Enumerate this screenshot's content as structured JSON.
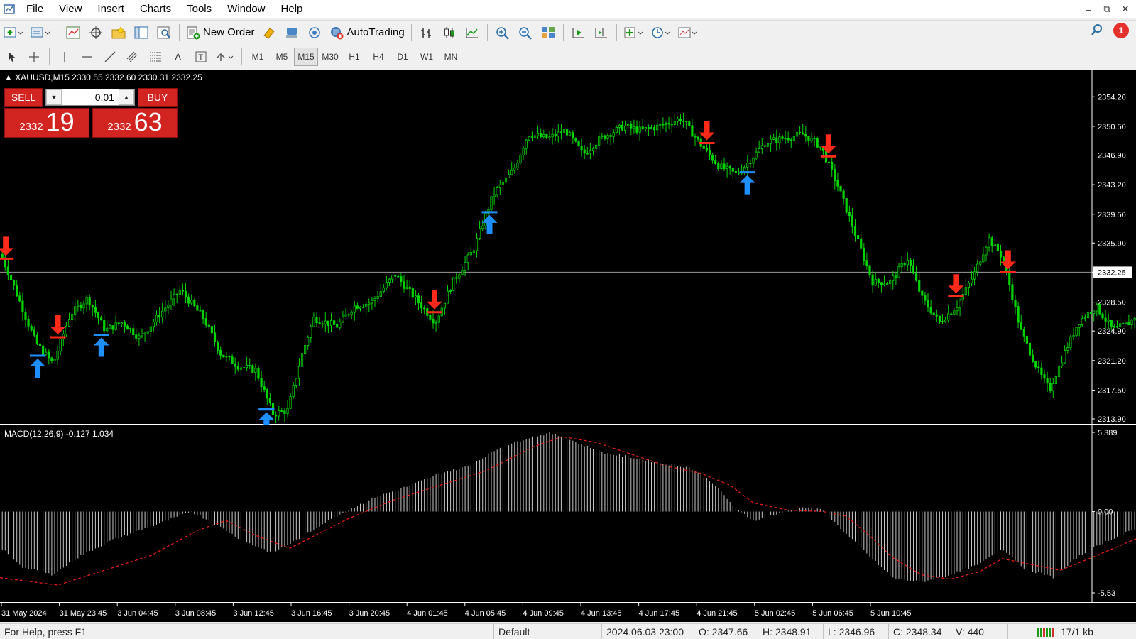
{
  "menu": {
    "items": [
      "File",
      "View",
      "Insert",
      "Charts",
      "Tools",
      "Window",
      "Help"
    ]
  },
  "toolbar": {
    "new_order_label": "New Order",
    "autotrading_label": "AutoTrading",
    "notification_count": "1"
  },
  "timeframes": {
    "items": [
      "M1",
      "M5",
      "M15",
      "M30",
      "H1",
      "H4",
      "D1",
      "W1",
      "MN"
    ],
    "active": "M15"
  },
  "chart": {
    "symbol_header": "XAUUSD,M15  2330.55 2332.60 2330.31 2332.25",
    "macd_header": "MACD(12,26,9) -0.127 1.034",
    "colors": {
      "background": "#000000",
      "bull_candle": "#00d400",
      "sell_arrow": "#ff2a1a",
      "buy_arrow": "#1e8fff",
      "macd_hist": "#c8c8c8",
      "macd_signal": "#e51a1a"
    }
  },
  "trade_panel": {
    "sell_label": "SELL",
    "buy_label": "BUY",
    "lot": "0.01",
    "sell_price_main": "2332",
    "sell_price_big": "19",
    "buy_price_main": "2332",
    "buy_price_big": "63"
  },
  "chart_data": {
    "type": "candlestick",
    "price_axis_ticks": [
      "2354.20",
      "2350.50",
      "2346.90",
      "2343.20",
      "2339.50",
      "2335.90",
      "2332.25",
      "2328.50",
      "2324.90",
      "2321.20",
      "2317.50",
      "2313.90"
    ],
    "current_price": "2332.25",
    "ylim": [
      2313.9,
      2356.0
    ],
    "time_axis_ticks": [
      "31 May 2024",
      "31 May 23:45",
      "3 Jun 04:45",
      "3 Jun 08:45",
      "3 Jun 12:45",
      "3 Jun 16:45",
      "3 Jun 20:45",
      "4 Jun 01:45",
      "4 Jun 05:45",
      "4 Jun 09:45",
      "4 Jun 13:45",
      "4 Jun 17:45",
      "4 Jun 21:45",
      "5 Jun 02:45",
      "5 Jun 06:45",
      "5 Jun 10:45"
    ],
    "price_path": [
      [
        0,
        2334.5
      ],
      [
        0.25,
        2330.0
      ],
      [
        0.6,
        2323.5
      ],
      [
        0.9,
        2320.8
      ],
      [
        1.2,
        2327.0
      ],
      [
        1.5,
        2329.0
      ],
      [
        1.8,
        2325.0
      ],
      [
        2.1,
        2326.0
      ],
      [
        2.4,
        2324.0
      ],
      [
        2.8,
        2327.5
      ],
      [
        3.1,
        2330.0
      ],
      [
        3.5,
        2326.5
      ],
      [
        3.8,
        2322.0
      ],
      [
        4.1,
        2320.5
      ],
      [
        4.4,
        2320.0
      ],
      [
        4.7,
        2314.5
      ],
      [
        4.95,
        2315.0
      ],
      [
        5.2,
        2322.0
      ],
      [
        5.4,
        2326.5
      ],
      [
        5.8,
        2325.5
      ],
      [
        6.1,
        2328.0
      ],
      [
        6.4,
        2328.5
      ],
      [
        6.8,
        2332.0
      ],
      [
        7.15,
        2329.0
      ],
      [
        7.5,
        2326.0
      ],
      [
        7.8,
        2331.0
      ],
      [
        8.15,
        2335.0
      ],
      [
        8.5,
        2342.0
      ],
      [
        8.85,
        2345.0
      ],
      [
        9.1,
        2349.5
      ],
      [
        9.45,
        2349.0
      ],
      [
        9.75,
        2350.0
      ],
      [
        10.05,
        2347.0
      ],
      [
        10.35,
        2349.0
      ],
      [
        10.75,
        2350.5
      ],
      [
        11.05,
        2350.0
      ],
      [
        11.35,
        2350.5
      ],
      [
        11.75,
        2351.5
      ],
      [
        12.1,
        2348.0
      ],
      [
        12.4,
        2345.5
      ],
      [
        12.7,
        2344.5
      ],
      [
        12.9,
        2346.0
      ],
      [
        13.2,
        2348.5
      ],
      [
        13.5,
        2349.0
      ],
      [
        13.85,
        2349.5
      ],
      [
        14.15,
        2348.0
      ],
      [
        14.45,
        2343.0
      ],
      [
        14.75,
        2337.0
      ],
      [
        15.05,
        2331.0
      ],
      [
        15.35,
        2331.0
      ],
      [
        15.65,
        2334.0
      ],
      [
        15.9,
        2329.0
      ],
      [
        16.2,
        2326.0
      ],
      [
        16.5,
        2328.0
      ],
      [
        16.8,
        2332.0
      ],
      [
        17.05,
        2336.5
      ],
      [
        17.3,
        2334.0
      ],
      [
        17.6,
        2325.0
      ],
      [
        17.9,
        2320.0
      ],
      [
        18.1,
        2317.5
      ],
      [
        18.35,
        2322.0
      ],
      [
        18.6,
        2326.0
      ],
      [
        18.9,
        2328.0
      ],
      [
        19.2,
        2325.0
      ],
      [
        19.5,
        2326.0
      ],
      [
        19.8,
        2329.0
      ],
      [
        20.1,
        2329.5
      ],
      [
        20.4,
        2328.0
      ],
      [
        20.7,
        2327.5
      ],
      [
        21.0,
        2326.0
      ],
      [
        21.3,
        2326.0
      ],
      [
        21.6,
        2327.0
      ],
      [
        21.9,
        2328.0
      ],
      [
        22.2,
        2328.3
      ],
      [
        22.5,
        2328.5
      ],
      [
        22.75,
        2329.5
      ],
      [
        23.05,
        2327.5
      ],
      [
        23.35,
        2331.0
      ],
      [
        23.65,
        2334.0
      ],
      [
        23.95,
        2336.0
      ],
      [
        24.25,
        2335.0
      ],
      [
        24.55,
        2339.0
      ],
      [
        24.8,
        2340.5
      ],
      [
        25.05,
        2336.5
      ],
      [
        25.3,
        2331.0
      ],
      [
        25.55,
        2330.0
      ],
      [
        25.8,
        2329.0
      ],
      [
        26.0,
        2332.2
      ]
    ],
    "sell_signals": [
      0.1,
      1.0,
      7.5,
      12.2,
      14.3,
      16.5,
      17.4,
      21.4
    ],
    "buy_signals": [
      0.65,
      1.75,
      4.6,
      4.6,
      8.45,
      12.9,
      20.3,
      23.5
    ],
    "macd": {
      "ylim": [
        -5.53,
        5.389
      ],
      "axis_ticks": [
        "5.389",
        "0.00",
        "-5.53"
      ],
      "histogram_path": [
        [
          0,
          -2.4
        ],
        [
          0.4,
          -3.8
        ],
        [
          0.9,
          -4.3
        ],
        [
          1.4,
          -3.0
        ],
        [
          1.9,
          -2.0
        ],
        [
          2.4,
          -1.3
        ],
        [
          2.9,
          -0.6
        ],
        [
          3.3,
          0.0
        ],
        [
          3.7,
          -0.8
        ],
        [
          4.2,
          -2.0
        ],
        [
          4.7,
          -2.8
        ],
        [
          5.0,
          -2.2
        ],
        [
          5.5,
          -1.0
        ],
        [
          6.0,
          0.1
        ],
        [
          6.5,
          1.0
        ],
        [
          7.1,
          1.8
        ],
        [
          7.6,
          2.6
        ],
        [
          8.1,
          3.1
        ],
        [
          8.6,
          4.3
        ],
        [
          9.1,
          5.0
        ],
        [
          9.5,
          5.35
        ],
        [
          9.9,
          4.8
        ],
        [
          10.4,
          4.0
        ],
        [
          10.9,
          3.7
        ],
        [
          11.4,
          3.3
        ],
        [
          11.9,
          3.0
        ],
        [
          12.3,
          2.0
        ],
        [
          12.7,
          0.2
        ],
        [
          13.0,
          -0.6
        ],
        [
          13.4,
          -0.2
        ],
        [
          13.8,
          0.3
        ],
        [
          14.2,
          0.1
        ],
        [
          14.6,
          -1.5
        ],
        [
          15.0,
          -3.0
        ],
        [
          15.4,
          -4.5
        ],
        [
          15.9,
          -4.8
        ],
        [
          16.4,
          -4.3
        ],
        [
          16.9,
          -3.6
        ],
        [
          17.3,
          -2.5
        ],
        [
          17.7,
          -3.9
        ],
        [
          18.2,
          -4.5
        ],
        [
          18.6,
          -3.1
        ],
        [
          19.1,
          -2.0
        ],
        [
          19.6,
          -1.2
        ],
        [
          20.1,
          -0.6
        ],
        [
          20.6,
          -0.3
        ],
        [
          21.1,
          -0.1
        ],
        [
          21.6,
          0.2
        ],
        [
          22.1,
          0.4
        ],
        [
          22.6,
          0.5
        ],
        [
          23.1,
          1.0
        ],
        [
          23.6,
          2.2
        ],
        [
          24.1,
          3.4
        ],
        [
          24.6,
          4.0
        ],
        [
          25.0,
          3.0
        ],
        [
          25.4,
          1.5
        ],
        [
          25.8,
          0.1
        ],
        [
          26.0,
          0.0
        ]
      ],
      "signal_path": [
        [
          0,
          -4.5
        ],
        [
          1.0,
          -5.0
        ],
        [
          1.8,
          -4.0
        ],
        [
          2.6,
          -3.0
        ],
        [
          3.4,
          -1.3
        ],
        [
          3.9,
          -0.6
        ],
        [
          4.4,
          -1.6
        ],
        [
          5.0,
          -2.5
        ],
        [
          5.5,
          -1.5
        ],
        [
          6.0,
          -0.5
        ],
        [
          6.8,
          0.8
        ],
        [
          7.6,
          1.8
        ],
        [
          8.4,
          2.8
        ],
        [
          9.2,
          4.4
        ],
        [
          9.7,
          5.1
        ],
        [
          10.3,
          4.7
        ],
        [
          10.9,
          3.9
        ],
        [
          11.5,
          3.1
        ],
        [
          12.1,
          2.6
        ],
        [
          12.6,
          1.8
        ],
        [
          13.0,
          0.6
        ],
        [
          13.6,
          0.1
        ],
        [
          14.2,
          0.0
        ],
        [
          14.6,
          -0.3
        ],
        [
          15.0,
          -1.6
        ],
        [
          15.4,
          -3.1
        ],
        [
          15.9,
          -4.3
        ],
        [
          16.4,
          -4.6
        ],
        [
          16.9,
          -4.1
        ],
        [
          17.3,
          -3.2
        ],
        [
          17.8,
          -3.6
        ],
        [
          18.3,
          -4.0
        ],
        [
          18.8,
          -3.2
        ],
        [
          19.4,
          -2.2
        ],
        [
          20.0,
          -1.2
        ],
        [
          20.6,
          -0.4
        ],
        [
          21.2,
          -0.1
        ],
        [
          21.8,
          0.3
        ],
        [
          22.4,
          0.4
        ],
        [
          23.0,
          0.6
        ],
        [
          23.6,
          1.4
        ],
        [
          24.2,
          2.6
        ],
        [
          24.8,
          3.3
        ],
        [
          25.3,
          3.0
        ],
        [
          25.8,
          1.6
        ],
        [
          26.0,
          1.0
        ]
      ]
    }
  },
  "status": {
    "help": "For Help, press F1",
    "profile": "Default",
    "time": "2024.06.03 23:00",
    "open": "O: 2347.66",
    "high": "H: 2348.91",
    "low": "L: 2346.96",
    "close": "C: 2348.34",
    "volume": "V: 440",
    "connection": "17/1 kb"
  }
}
